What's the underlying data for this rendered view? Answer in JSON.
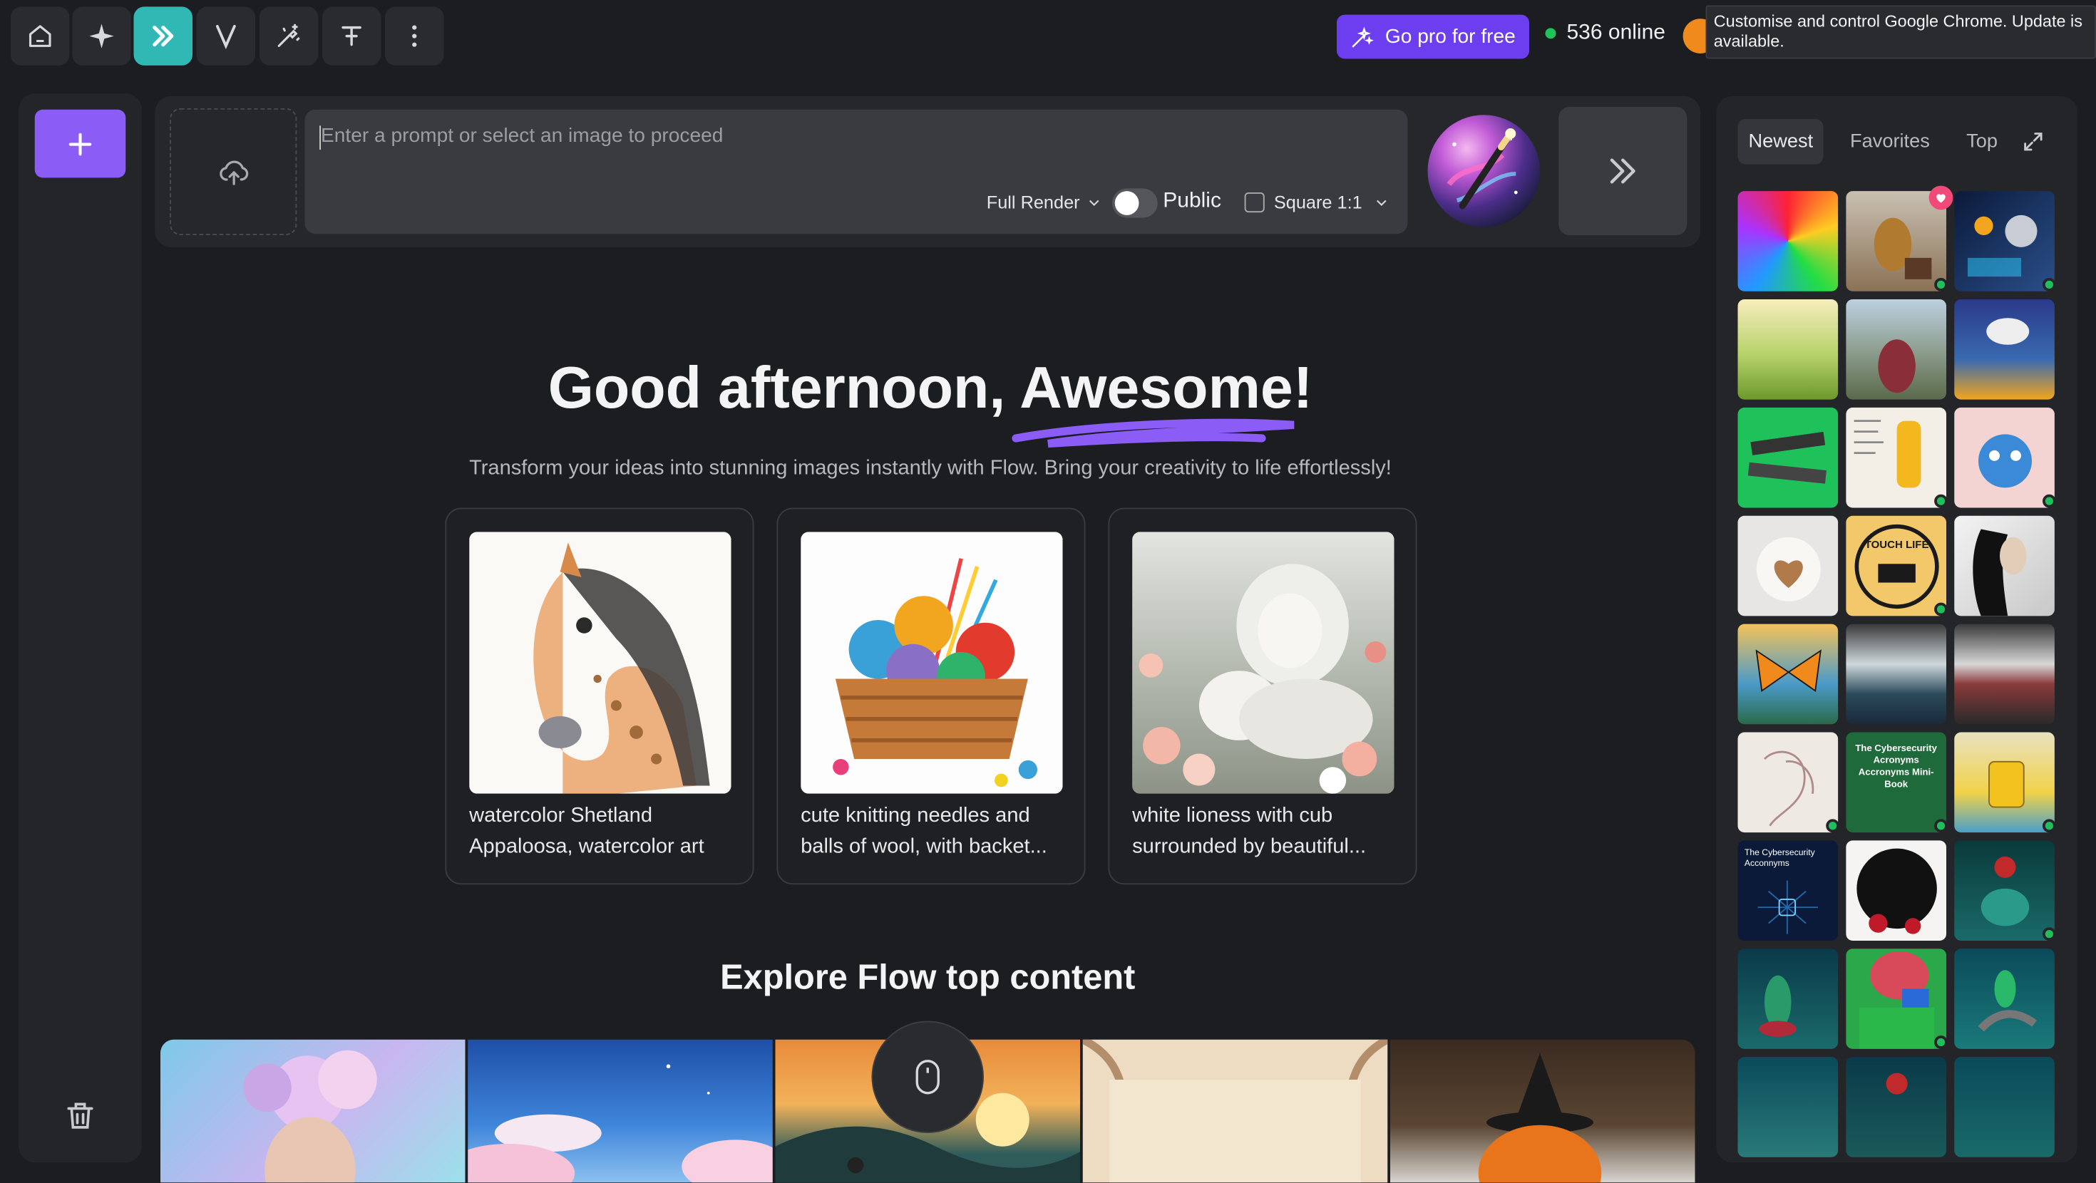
{
  "toolbar": {
    "icons": [
      "home-icon",
      "sparkle-icon",
      "double-chevron-icon",
      "v-logo-icon",
      "magic-brush-icon",
      "text-tool-icon",
      "more-vertical-icon"
    ],
    "active_index": 2
  },
  "header": {
    "go_pro_label": "Go pro for free",
    "online_text": "536 online",
    "tooltip_text": "Customise and control Google Chrome. Update is available."
  },
  "prompt": {
    "placeholder": "Enter a prompt or select an image to proceed",
    "render_mode": "Full Render",
    "visibility_label": "Public",
    "aspect_label": "Square 1:1"
  },
  "main": {
    "greeting_prefix": "Good afternoon, ",
    "greeting_name": "Awesome!",
    "subtitle": "Transform your ideas into stunning images instantly with Flow. Bring your creativity to life effortlessly!",
    "cards": [
      {
        "caption_line1": "watercolor Shetland",
        "caption_line2": "Appaloosa, watercolor art"
      },
      {
        "caption_line1": "cute knitting needles and",
        "caption_line2": "balls of wool, with backet..."
      },
      {
        "caption_line1": "white lioness with cub",
        "caption_line2": "surrounded by beautiful..."
      }
    ],
    "explore_title": "Explore Flow top content"
  },
  "gallery": {
    "tabs": [
      "Newest",
      "Favorites",
      "Top"
    ],
    "active_tab": "Newest",
    "thumb_texts": {
      "stamp": "TOUCH LIFE",
      "book_green": "The Cybersecurity Acronyms Accronyms Mini-Book",
      "book_blue": "The Cybersecurity Acconnyms"
    }
  },
  "colors": {
    "accent": "#8b5cf6",
    "go_pro": "#6d3df0",
    "active_tool": "#2fb8b4",
    "online_dot": "#20c25a"
  }
}
